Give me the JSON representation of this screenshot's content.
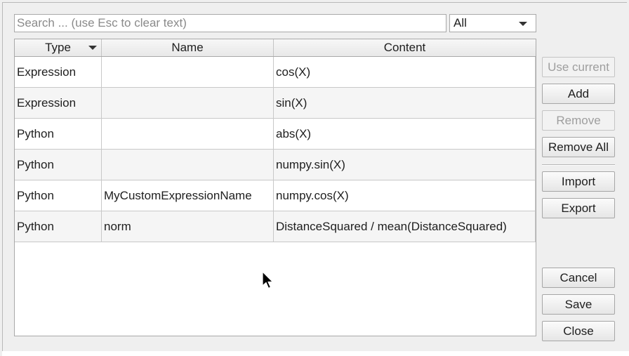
{
  "search": {
    "placeholder": "Search ... (use Esc to clear text)"
  },
  "filter": {
    "selected": "All"
  },
  "table": {
    "columns": [
      "Type",
      "Name",
      "Content"
    ],
    "rows": [
      {
        "type": "Expression",
        "name": "",
        "content": "cos(X)"
      },
      {
        "type": "Expression",
        "name": "",
        "content": "sin(X)"
      },
      {
        "type": "Python",
        "name": "",
        "content": "abs(X)"
      },
      {
        "type": "Python",
        "name": "",
        "content": "numpy.sin(X)"
      },
      {
        "type": "Python",
        "name": "MyCustomExpressionName",
        "content": "numpy.cos(X)"
      },
      {
        "type": "Python",
        "name": "norm",
        "content": "DistanceSquared / mean(DistanceSquared)"
      }
    ]
  },
  "buttons": {
    "use_current": "Use current",
    "add": "Add",
    "remove": "Remove",
    "remove_all": "Remove All",
    "import": "Import",
    "export": "Export",
    "cancel": "Cancel",
    "save": "Save",
    "close": "Close"
  },
  "icons": {
    "sort": "sort-descending-icon",
    "dropdown": "chevron-down-icon",
    "cursor": "mouse-pointer-icon"
  }
}
